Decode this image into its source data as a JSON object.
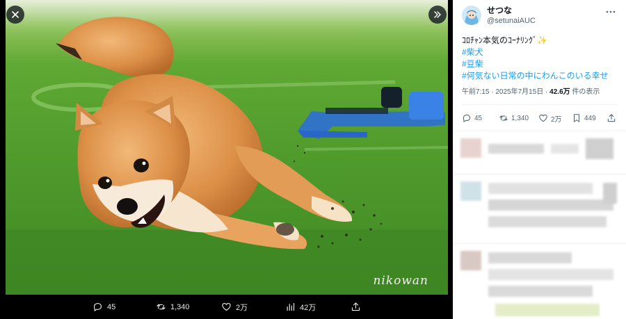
{
  "viewer": {
    "watermark": "nikowan",
    "actions": {
      "replies": "45",
      "retweets": "1,340",
      "likes": "2万",
      "views": "42万"
    }
  },
  "tweet": {
    "display_name": "せつな",
    "handle": "@setunaiAUC",
    "text_line1": "ｺﾛﾁｬﾝ本気のｺｰﾅﾘﾝｸﾞ",
    "sparkle": "✨",
    "hashtags": [
      "#柴犬",
      "#豆柴",
      "#何気ない日常の中にわんこのいる幸せ"
    ],
    "time": "午前7:15 · 2025年7月15日 · ",
    "view_count": "42.6万",
    "view_suffix": " 件の表示",
    "stats": {
      "replies": "45",
      "retweets": "1,340",
      "likes": "2万",
      "bookmarks": "449"
    }
  },
  "colors": {
    "accent": "#1d9bf0",
    "text_primary": "#0f1419",
    "text_secondary": "#536471"
  },
  "icons": [
    "close-icon",
    "expand-icon",
    "reply-icon",
    "retweet-icon",
    "like-icon",
    "views-icon",
    "share-icon",
    "more-icon",
    "bookmark-icon"
  ]
}
